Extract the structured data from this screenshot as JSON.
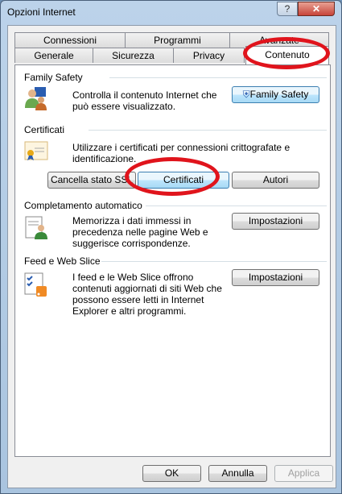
{
  "window": {
    "title": "Opzioni Internet",
    "help": "?",
    "close": "✕"
  },
  "tabs_row1": [
    "Connessioni",
    "Programmi",
    "Avanzate"
  ],
  "tabs_row2": [
    "Generale",
    "Sicurezza",
    "Privacy",
    "Contenuto"
  ],
  "active_tab": "Contenuto",
  "family_safety": {
    "heading": "Family Safety",
    "text": "Controlla il contenuto Internet che può essere visualizzato.",
    "button": "Family Safety"
  },
  "certificati": {
    "heading": "Certificati",
    "text": "Utilizzare i certificati per connessioni crittografate e identificazione.",
    "buttons": [
      "Cancella stato SSL",
      "Certificati",
      "Autori"
    ]
  },
  "completamento": {
    "heading": "Completamento automatico",
    "text": "Memorizza i dati immessi in precedenza nelle pagine Web e suggerisce corrispondenze.",
    "button": "Impostazioni"
  },
  "feed": {
    "heading": "Feed e Web Slice",
    "text": "I feed e le Web Slice offrono contenuti aggiornati di siti Web che possono essere letti in Internet Explorer e altri programmi.",
    "button": "Impostazioni"
  },
  "footer": {
    "ok": "OK",
    "cancel": "Annulla",
    "apply": "Applica"
  },
  "annotation_color": "#e0141c"
}
